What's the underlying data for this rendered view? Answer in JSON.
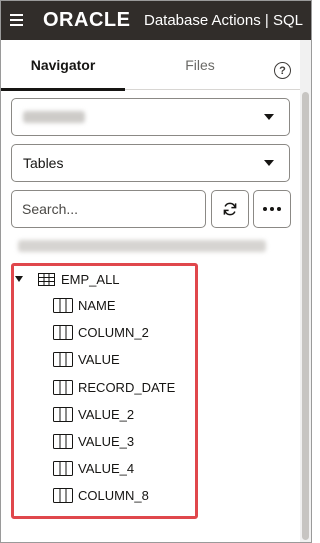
{
  "header": {
    "brand": "ORACLE",
    "app_title": "Database Actions | SQL",
    "menu_icon": "hamburger-menu-icon"
  },
  "tabs": [
    {
      "label": "Navigator",
      "active": true
    },
    {
      "label": "Files",
      "active": false
    }
  ],
  "help_icon": {
    "glyph": "?"
  },
  "schema_select": {
    "value": ""
  },
  "object_type_select": {
    "value": "Tables"
  },
  "search": {
    "placeholder": "Search...",
    "value": ""
  },
  "toolbar": {
    "refresh_icon": "refresh-icon",
    "more_icon": "more-options-icon"
  },
  "tree": {
    "root": {
      "label": "EMP_ALL",
      "expanded": true,
      "icon": "table-icon"
    },
    "columns": [
      "NAME",
      "COLUMN_2",
      "VALUE",
      "RECORD_DATE",
      "VALUE_2",
      "VALUE_3",
      "VALUE_4",
      "COLUMN_8"
    ]
  },
  "colors": {
    "header_bg": "#312d2a",
    "highlight": "#e0474c"
  }
}
